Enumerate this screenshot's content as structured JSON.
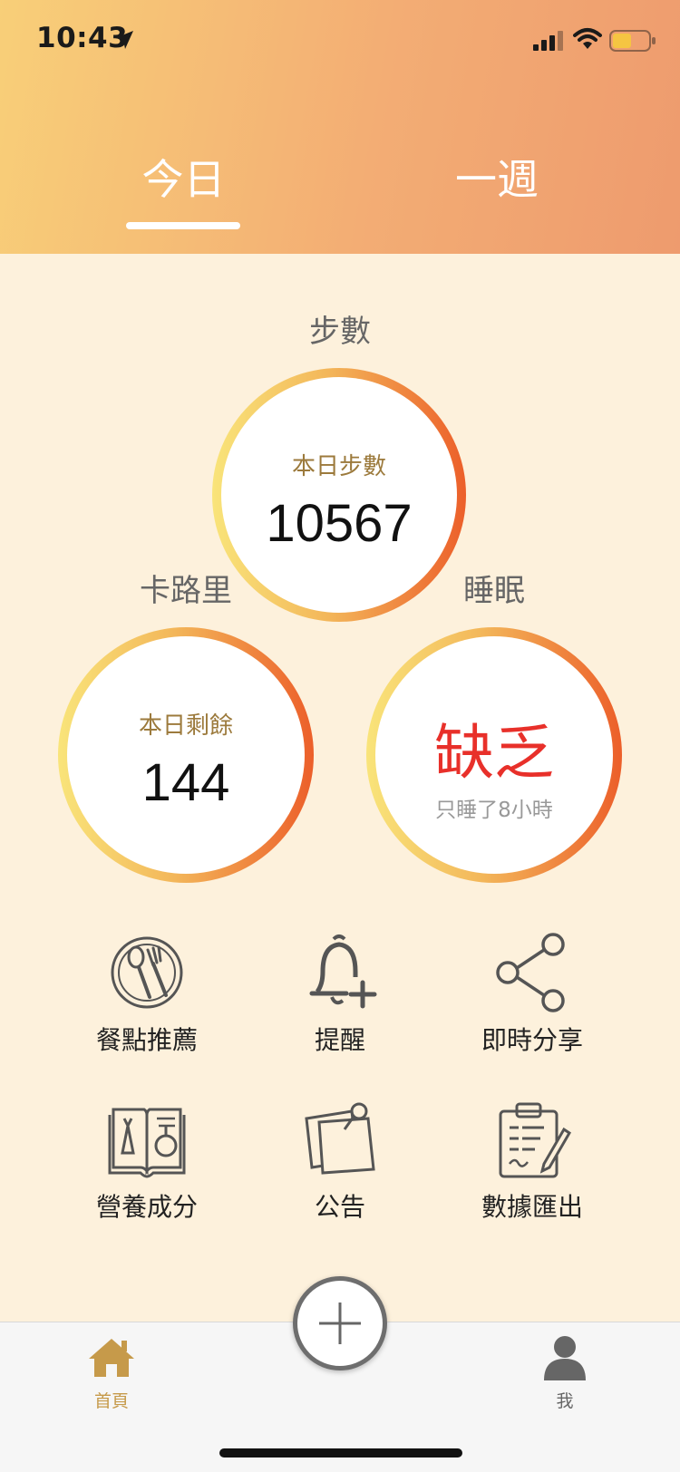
{
  "status_bar": {
    "time": "10:43",
    "icons": [
      "location-arrow-icon",
      "signal-icon",
      "wifi-icon",
      "battery-icon"
    ],
    "battery_color": "#f5c542"
  },
  "tabs": [
    {
      "label": "今日",
      "active": true
    },
    {
      "label": "一週",
      "active": false
    }
  ],
  "steps": {
    "section_label": "步數",
    "caption": "本日步數",
    "value": "10567"
  },
  "calories": {
    "section_label": "卡路里",
    "caption": "本日剩餘",
    "value": "144"
  },
  "sleep": {
    "section_label": "睡眠",
    "status": "缺乏",
    "note": "只睡了8小時",
    "status_color": "#e8302a"
  },
  "features": [
    {
      "label": "餐點推薦",
      "icon": "plate-utensils-icon"
    },
    {
      "label": "提醒",
      "icon": "bell-plus-icon"
    },
    {
      "label": "即時分享",
      "icon": "share-icon"
    },
    {
      "label": "營養成分",
      "icon": "nutrition-book-icon"
    },
    {
      "label": "公告",
      "icon": "pinned-notes-icon"
    },
    {
      "label": "數據匯出",
      "icon": "clipboard-export-icon"
    }
  ],
  "bottom_nav": {
    "home_label": "首頁",
    "me_label": "我",
    "active_color": "#c69a4a",
    "add_icon": "plus-icon"
  },
  "colors": {
    "header_gradient_start": "#f8cf78",
    "header_gradient_end": "#ee9b6e",
    "background": "#fdf1dc",
    "ring_gradient_start": "#f9e47a",
    "ring_gradient_end": "#ec5f2a"
  }
}
